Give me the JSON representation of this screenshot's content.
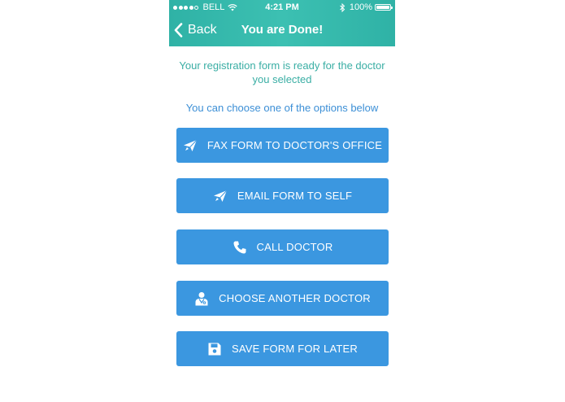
{
  "status": {
    "carrier": "BELL",
    "time": "4:21 PM",
    "battery": "100%",
    "signal_bars": 4,
    "signal_total": 5
  },
  "nav": {
    "back_label": "Back",
    "title": "You are Done!"
  },
  "content": {
    "intro": "Your registration form is ready for the doctor you selected",
    "hint": "You can choose one of the options below"
  },
  "buttons": [
    {
      "label": "FAX FORM TO DOCTOR'S OFFICE",
      "icon": "paper-plane-icon"
    },
    {
      "label": "EMAIL FORM TO SELF",
      "icon": "paper-plane-icon"
    },
    {
      "label": "CALL DOCTOR",
      "icon": "phone-icon"
    },
    {
      "label": "CHOOSE ANOTHER DOCTOR",
      "icon": "doctor-icon"
    },
    {
      "label": "SAVE FORM FOR LATER",
      "icon": "floppy-disk-icon"
    }
  ],
  "colors": {
    "header": "#3cc0b2",
    "intro_text": "#3aaea4",
    "hint_text": "#3c8fd6",
    "button": "#3b97e0"
  }
}
